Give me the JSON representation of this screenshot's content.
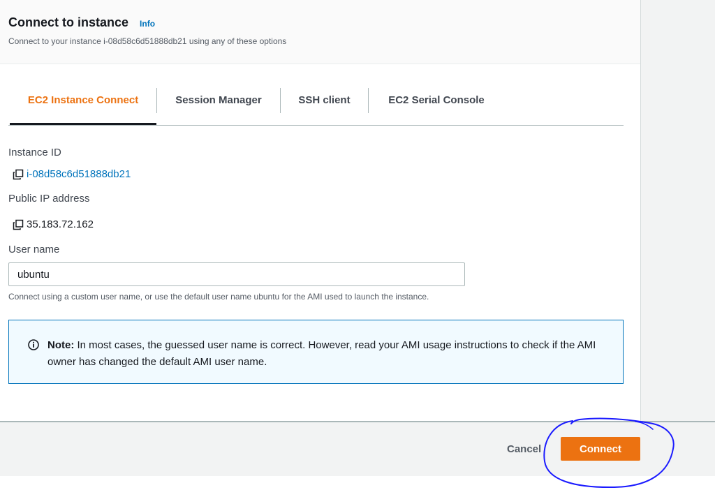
{
  "header": {
    "title": "Connect to instance",
    "info_label": "Info",
    "subtitle": "Connect to your instance i-08d58c6d51888db21 using any of these options"
  },
  "tabs": [
    {
      "label": "EC2 Instance Connect",
      "active": true
    },
    {
      "label": "Session Manager",
      "active": false
    },
    {
      "label": "SSH client",
      "active": false
    },
    {
      "label": "EC2 Serial Console",
      "active": false
    }
  ],
  "instance": {
    "id_label": "Instance ID",
    "id_value": "i-08d58c6d51888db21",
    "ip_label": "Public IP address",
    "ip_value": "35.183.72.162"
  },
  "username": {
    "label": "User name",
    "value": "ubuntu",
    "hint": "Connect using a custom user name, or use the default user name ubuntu for the AMI used to launch the instance."
  },
  "note": {
    "strong": "Note:",
    "text": " In most cases, the guessed user name is correct. However, read your AMI usage instructions to check if the AMI owner has changed the default AMI user name."
  },
  "footer": {
    "cancel_label": "Cancel",
    "connect_label": "Connect"
  },
  "icons": {
    "copy": "copy-icon",
    "info": "info-circle-icon"
  },
  "colors": {
    "accent": "#ec7211",
    "link": "#0073bb",
    "annotation": "#1a1aff"
  }
}
